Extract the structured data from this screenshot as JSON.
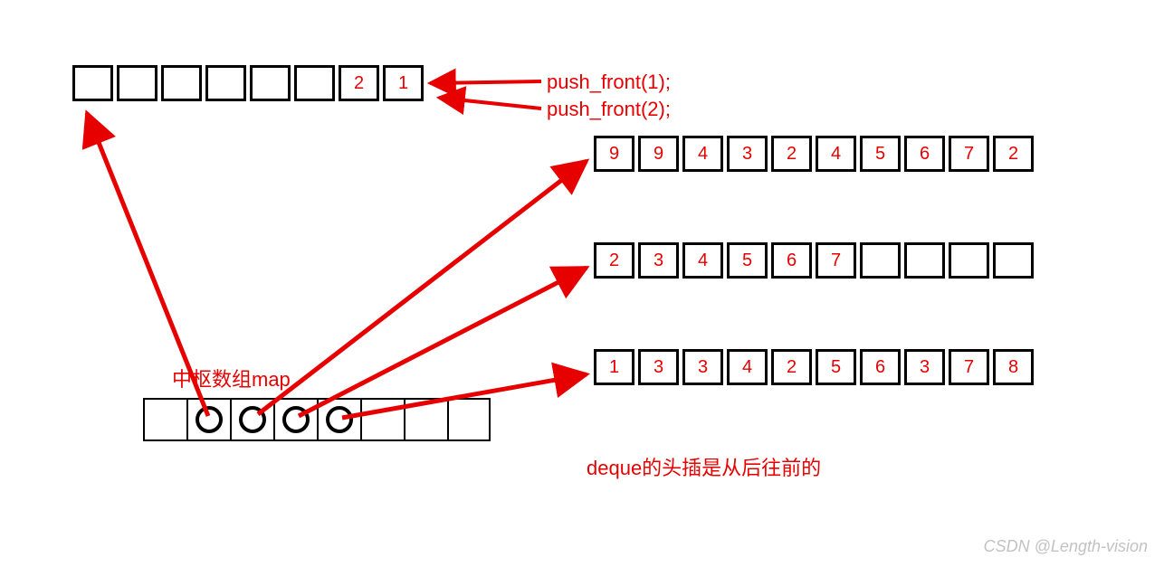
{
  "labels": {
    "push1": "push_front(1);",
    "push2": "push_front(2);",
    "map_title": "中枢数组map",
    "head_insert_note": "deque的头插是从后往前的",
    "watermark": "CSDN @Length-vision"
  },
  "blocks": {
    "top": [
      "",
      "",
      "",
      "",
      "",
      "",
      "2",
      "1"
    ],
    "row1": [
      "9",
      "9",
      "4",
      "3",
      "2",
      "4",
      "5",
      "6",
      "7",
      "2"
    ],
    "row2": [
      "2",
      "3",
      "4",
      "5",
      "6",
      "7",
      "",
      "",
      "",
      ""
    ],
    "row3": [
      "1",
      "3",
      "3",
      "4",
      "2",
      "5",
      "6",
      "3",
      "7",
      "8"
    ]
  },
  "map": {
    "cells": 8,
    "ring_indices": [
      1,
      2,
      3,
      4
    ]
  },
  "colors": {
    "accent": "#e60000",
    "border": "#000000"
  }
}
